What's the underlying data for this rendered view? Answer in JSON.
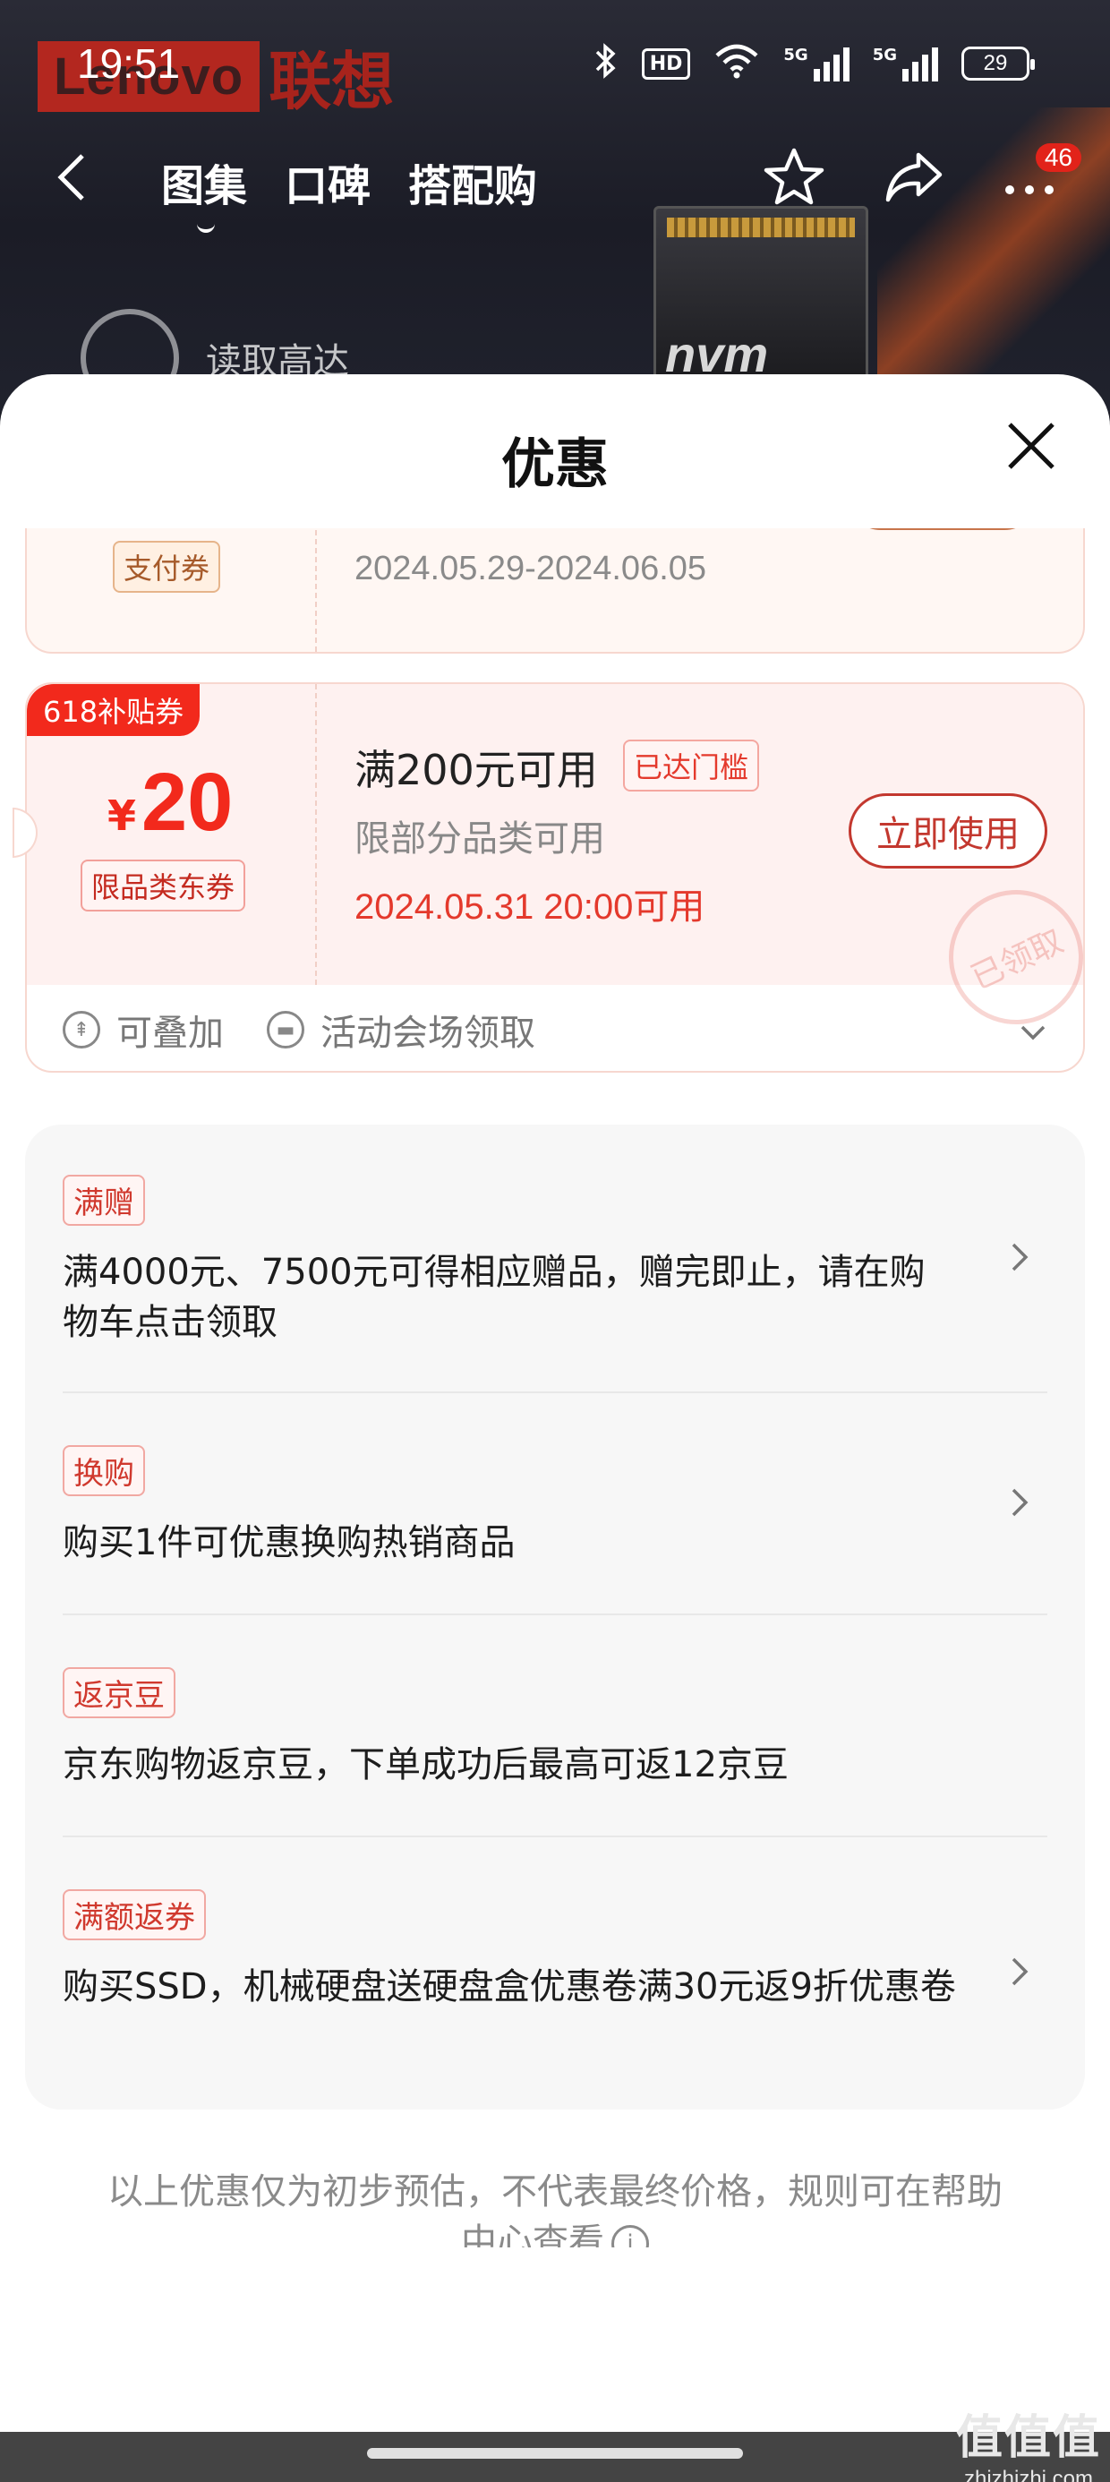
{
  "status_bar": {
    "time": "19:51",
    "battery": "29",
    "network_tag": "5G",
    "hd_label": "HD"
  },
  "brand": {
    "en": "Lenovo",
    "cn": "联想"
  },
  "product_image_text": "nvm",
  "nav": {
    "tabs": [
      {
        "label": "图集"
      },
      {
        "label": "口碑"
      },
      {
        "label": "搭配购"
      }
    ],
    "message_count": "46"
  },
  "reading_text": "读取高达",
  "sheet": {
    "title": "优惠"
  },
  "coupon_partial": {
    "type_chip": "支付券",
    "date_range": "2024.05.29-2024.06.05"
  },
  "coupon_main": {
    "ribbon": "618补贴券",
    "currency": "¥",
    "amount": "20",
    "type_chip": "限品类东券",
    "condition": "满200元可用",
    "reached_chip": "已达门槛",
    "scope": "限部分品类可用",
    "available_time": "2024.05.31 20:00可用",
    "use_button": "立即使用",
    "stamp": "已领取",
    "stackable_label": "可叠加",
    "source_label": "活动会场领取"
  },
  "promotions": [
    {
      "tag": "满赠",
      "text": "满4000元、7500元可得相应赠品，赠完即止，请在购物车点击领取"
    },
    {
      "tag": "换购",
      "text": "购买1件可优惠换购热销商品"
    },
    {
      "tag": "返京豆",
      "text": "京东购物返京豆，下单成功后最高可返12京豆"
    },
    {
      "tag": "满额返券",
      "text": "购买SSD，机械硬盘送硬盘盒优惠卷满30元返9折优惠卷"
    }
  ],
  "disclaimer": "以上优惠仅为初步预估，不代表最终价格，规则可在帮助中心查看",
  "watermark": {
    "logo": "值值值",
    "url": "zhizhizhi.com"
  },
  "colors": {
    "accent_red": "#f2291c",
    "sheet_bg": "#ffffff",
    "promo_bg": "#f7f7f7"
  }
}
